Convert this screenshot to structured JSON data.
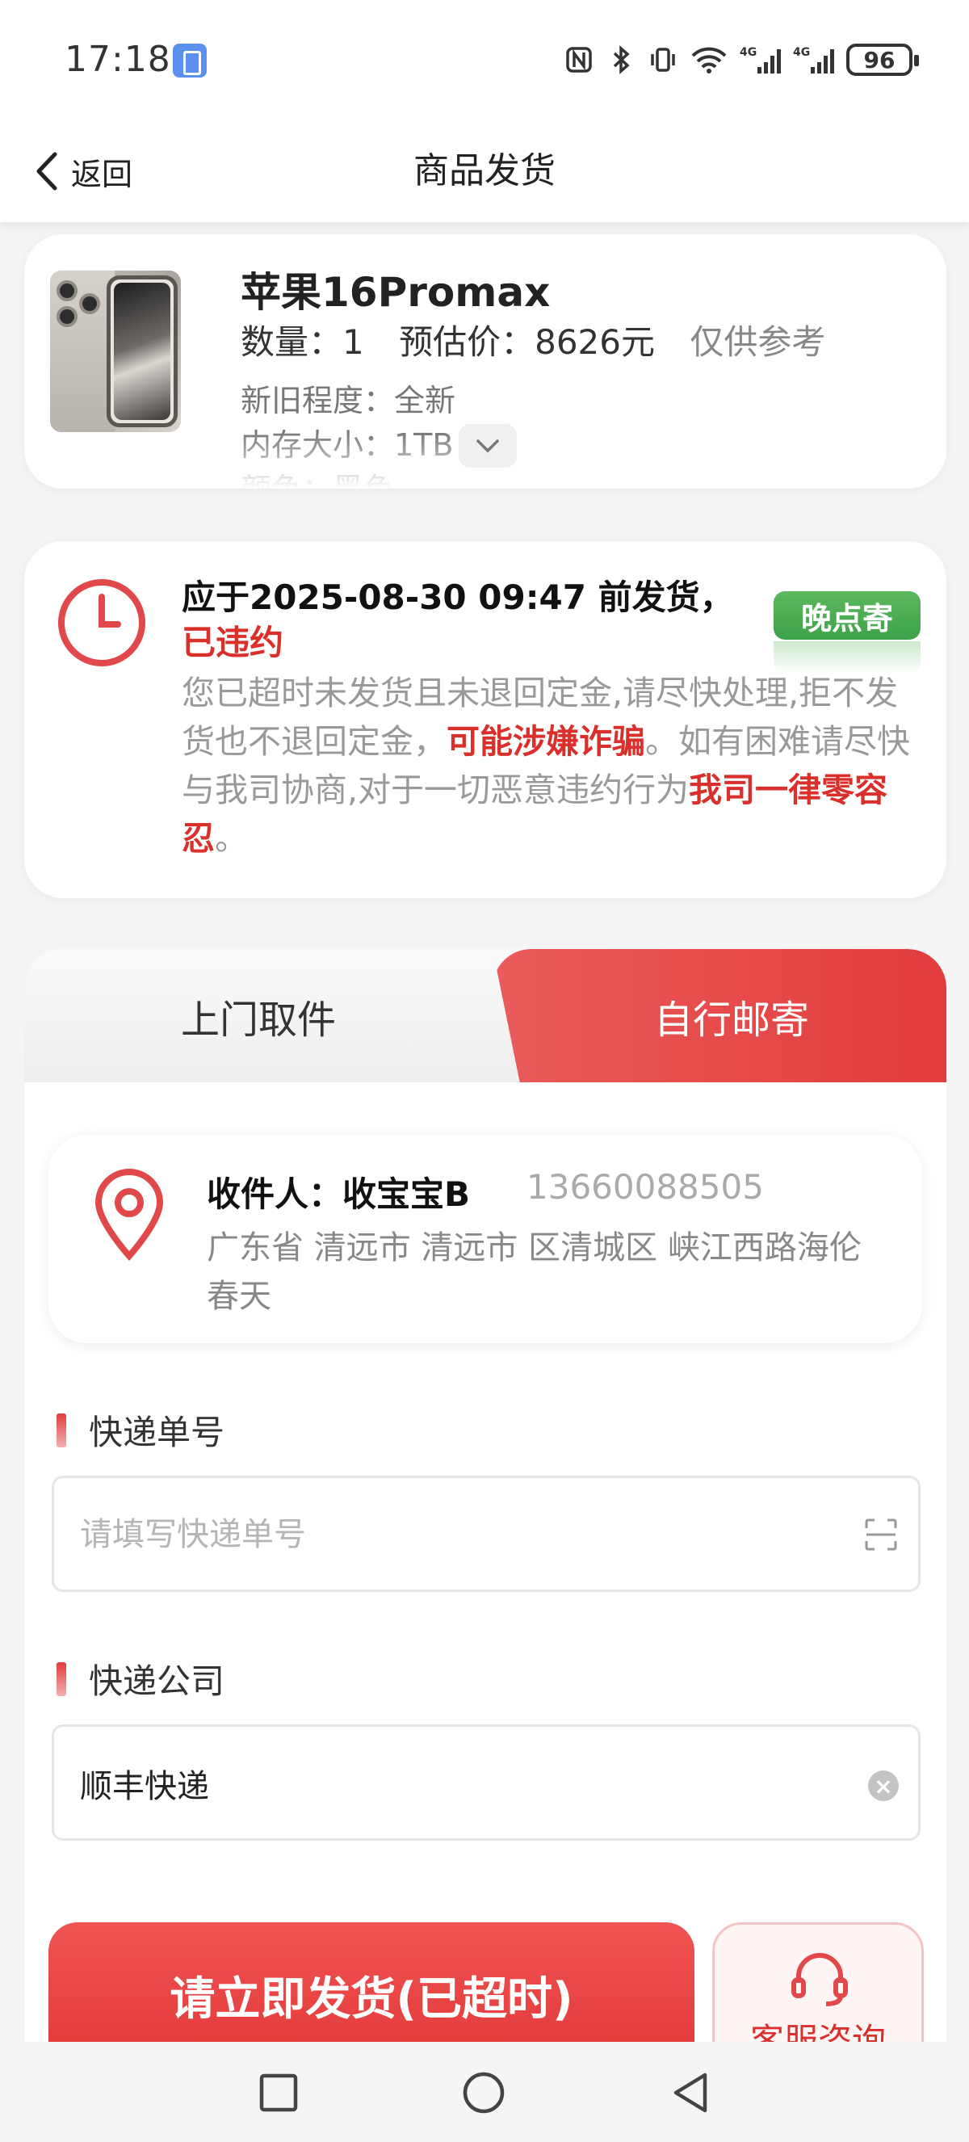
{
  "status_bar": {
    "time": "17:18",
    "battery": "96",
    "icons": [
      "nfc-icon",
      "bluetooth-icon",
      "vibrate-icon",
      "wifi-icon",
      "signal-4g-icon",
      "signal-4g-icon"
    ]
  },
  "header": {
    "back_label": "返回",
    "title": "商品发货"
  },
  "product": {
    "name": "苹果16Promax",
    "quantity_label": "数量：1",
    "price_label": "预估价：8626元",
    "price_note": "仅供参考",
    "condition": "新旧程度：全新",
    "storage": "内存大小：1TB",
    "color": "颜色：黑色"
  },
  "warning": {
    "deadline": "应于2025-08-30 09:47 前发货，",
    "status": "已违约",
    "late_button": "晚点寄",
    "text_1": "您已超时未发货且未退回定金,请尽快处理,拒不发货也不退回定金，",
    "text_red_1": "可能涉嫌诈骗",
    "text_2": "。如有困难请尽快与我司协商,对于一切恶意违约行为",
    "text_red_2": "我司一律零容忍",
    "text_3": "。"
  },
  "shipping": {
    "tab_pickup": "上门取件",
    "tab_self": "自行邮寄",
    "active_tab": "自行邮寄",
    "recipient": "收件人：收宝宝B",
    "phone": "13660088505",
    "address": "广东省 清远市 清远市 区清城区 峡江西路海伦春天",
    "tracking_label": "快递单号",
    "tracking_placeholder": "请填写快递单号",
    "company_label": "快递公司",
    "company_value": "顺丰快递",
    "submit_button": "请立即发货(已超时)",
    "service_button": "客服咨询"
  },
  "colors": {
    "accent_red": "#e23c3c",
    "late_green": "#4caf50"
  }
}
